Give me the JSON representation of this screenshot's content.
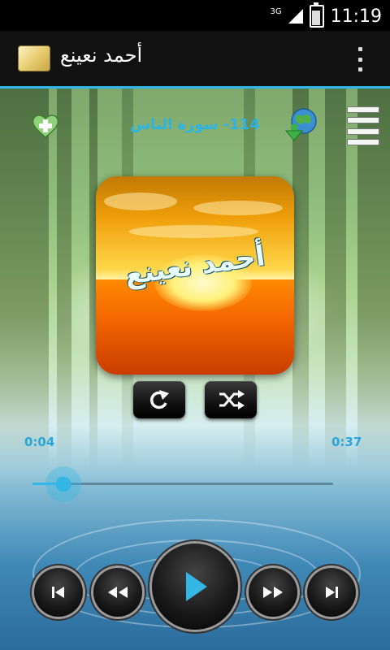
{
  "status_bar": {
    "network": "3G",
    "time": "11:19"
  },
  "app": {
    "title": "أحمد نعينع"
  },
  "player": {
    "track_title": "114- سورة الناس",
    "art_text": "أحمد نعينع",
    "elapsed": "0:04",
    "duration": "0:37",
    "progress": 0.108
  },
  "colors": {
    "accent": "#33b5e5",
    "title_text": "#2bb4e6"
  },
  "icons": [
    "add-favorite-icon",
    "download-globe-icon",
    "playlist-menu-icon",
    "repeat-icon",
    "shuffle-icon",
    "skip-previous-icon",
    "rewind-icon",
    "play-icon",
    "fast-forward-icon",
    "skip-next-icon",
    "overflow-menu-icon"
  ]
}
